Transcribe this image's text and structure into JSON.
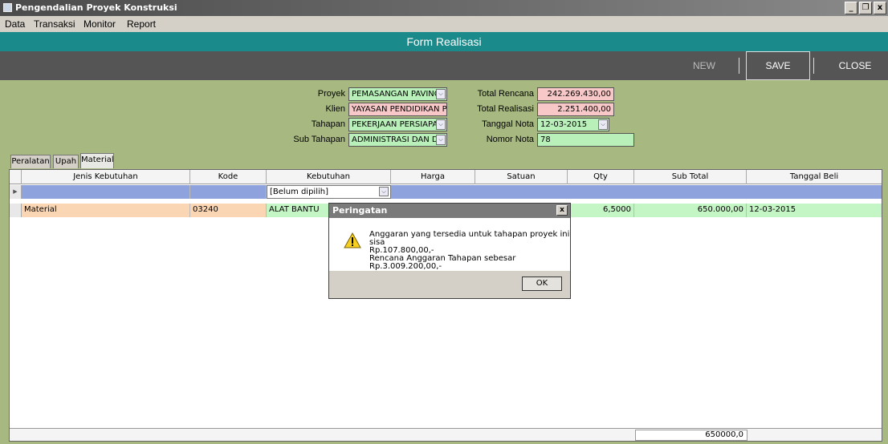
{
  "window": {
    "title": "Pengendalian Proyek Konstruksi",
    "btn_min": "_",
    "btn_restore": "ő",
    "btn_close": "x"
  },
  "menu": [
    "Data",
    "Transaksi",
    "Monitor",
    "Report"
  ],
  "form_title": "Form Realisasi",
  "toolbar": {
    "new": "NEW",
    "save": "SAVE",
    "close": "CLOSE"
  },
  "fields": {
    "proyek_label": "Proyek",
    "proyek_value": "PEMASANGAN PAVING ...",
    "klien_label": "Klien",
    "klien_value": "YAYASAN PENDIDIKAN PUSPA",
    "tahapan_label": "Tahapan",
    "tahapan_value": "PEKERJAAN PERSIAPAN",
    "subtahapan_label": "Sub Tahapan",
    "subtahapan_value": "ADMINISTRASI DAN D...",
    "total_rencana_label": "Total Rencana",
    "total_rencana_value": "242.269.430,00",
    "total_realisasi_label": "Total Realisasi",
    "total_realisasi_value": "2.251.400,00",
    "tanggal_nota_label": "Tanggal Nota",
    "tanggal_nota_value": "12-03-2015",
    "nomor_nota_label": "Nomor Nota",
    "nomor_nota_value": "78"
  },
  "tabs": [
    "Peralatan",
    "Upah",
    "Material"
  ],
  "grid": {
    "headers": [
      "Jenis Kebutuhan",
      "Kode",
      "Kebutuhan",
      "Harga",
      "Satuan",
      "Qty",
      "Sub Total",
      "Tanggal Beli"
    ],
    "new_row_kebutuhan": "[Belum dipilih]",
    "row": {
      "jenis": "Material",
      "kode": "03240",
      "kebutuhan": "ALAT BANTU",
      "qty": "6,5000",
      "subtotal": "650.000,00",
      "tanggal": "12-03-2015"
    },
    "footer_total": "650000,0"
  },
  "dialog": {
    "title": "Peringatan",
    "line1": "Anggaran yang tersedia untuk tahapan proyek ini sisa",
    "line2": "Rp.107.800,00,-",
    "line3": "Rencana Anggaran Tahapan sebesar Rp.3.009.200,00,-",
    "ok": "OK",
    "close": "x"
  },
  "colors": {
    "form_bg": "#a7b981",
    "title_bar": "#1a8a8a",
    "toolbar": "#555555",
    "field_green": "#b9f0b9",
    "field_pink": "#f8c8c8",
    "grid_new_row": "#8ea2dd",
    "row_highlight": "#fbd6b5",
    "row_green": "#c4f5c4"
  }
}
